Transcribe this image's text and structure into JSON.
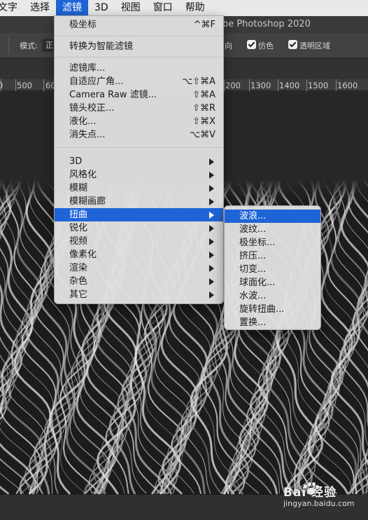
{
  "menubar": {
    "items": [
      {
        "label": "文字"
      },
      {
        "label": "选择"
      },
      {
        "label": "滤镜"
      },
      {
        "label": "3D"
      },
      {
        "label": "视图"
      },
      {
        "label": "窗口"
      },
      {
        "label": "帮助"
      }
    ]
  },
  "window": {
    "title": "obe Photoshop 2020"
  },
  "options": {
    "mode_label": "模式:",
    "mode_value": "正",
    "direction_label": "向",
    "dither_label": "仿色",
    "transparency_label": "透明区域"
  },
  "ruler": {
    "ticks": [
      "0",
      "500",
      "60",
      "200",
      "1300",
      "1400",
      "1500",
      "1600"
    ]
  },
  "filter_menu": {
    "items": [
      {
        "label": "极坐标",
        "shortcut": "^⌘F"
      },
      {
        "label": "转换为智能滤镜"
      },
      {
        "label": "滤镜库..."
      },
      {
        "label": "自适应广角...",
        "shortcut": "⌥⇧⌘A"
      },
      {
        "label": "Camera Raw 滤镜...",
        "shortcut": "⇧⌘A"
      },
      {
        "label": "镜头校正...",
        "shortcut": "⇧⌘R"
      },
      {
        "label": "液化...",
        "shortcut": "⇧⌘X"
      },
      {
        "label": "消失点...",
        "shortcut": "⌥⌘V"
      },
      {
        "label": "3D"
      },
      {
        "label": "风格化"
      },
      {
        "label": "模糊"
      },
      {
        "label": "模糊画廊"
      },
      {
        "label": "扭曲"
      },
      {
        "label": "锐化"
      },
      {
        "label": "视频"
      },
      {
        "label": "像素化"
      },
      {
        "label": "渲染"
      },
      {
        "label": "杂色"
      },
      {
        "label": "其它"
      }
    ]
  },
  "distort_menu": {
    "items": [
      {
        "label": "波浪..."
      },
      {
        "label": "波纹..."
      },
      {
        "label": "极坐标..."
      },
      {
        "label": "挤压..."
      },
      {
        "label": "切变..."
      },
      {
        "label": "球面化..."
      },
      {
        "label": "水波..."
      },
      {
        "label": "旋转扭曲..."
      },
      {
        "label": "置换..."
      }
    ]
  },
  "watermark": {
    "brand": "Bai 经验",
    "url": "jingyan.baidu.com"
  },
  "colors": {
    "highlight": "#1f64d6",
    "menu_bg": "#e0e0e0",
    "app_bg": "#272727"
  }
}
